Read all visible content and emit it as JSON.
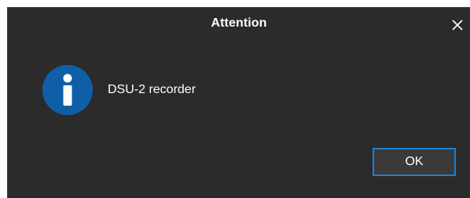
{
  "dialog": {
    "title": "Attention",
    "message": "DSU-2 recorder",
    "icon": "info-icon",
    "ok_label": "OK",
    "close_icon": "close-icon"
  },
  "colors": {
    "background": "#2b2b2b",
    "text": "#ffffff",
    "icon_blue": "#0f5fa8",
    "button_border": "#1e7fd1",
    "button_bg": "#3a3a3a"
  }
}
